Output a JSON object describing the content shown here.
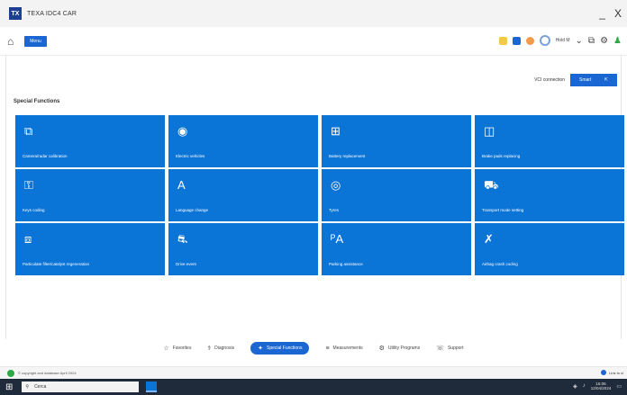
{
  "window": {
    "logo_text": "TX",
    "title": "TEXA IDC4 CAR",
    "minimize": "_",
    "close": "X"
  },
  "toolbar": {
    "home": "⌂",
    "menu_label": "Menu",
    "user_name": "Hold M"
  },
  "connection": {
    "label": "VCI connection",
    "button_label": "Smart",
    "button_icon": "⇱"
  },
  "section": {
    "title": "Special Functions"
  },
  "tiles": [
    {
      "label": "Camera/radar calibration",
      "icon": "⧉"
    },
    {
      "label": "Electric vehicles",
      "icon": "◉"
    },
    {
      "label": "Battery replacement",
      "icon": "⊞"
    },
    {
      "label": "Brake pads replacing",
      "icon": "◫"
    },
    {
      "label": "Keys coding",
      "icon": "⚿"
    },
    {
      "label": "Language change",
      "icon": "A"
    },
    {
      "label": "Tyres",
      "icon": "◎"
    },
    {
      "label": "Transport mode setting",
      "icon": "⛟"
    },
    {
      "label": "Particulate filter/catalyst regeneration",
      "icon": "⧈"
    },
    {
      "label": "Drive event",
      "icon": "⛐"
    },
    {
      "label": "Parking assistance",
      "icon": "ᴾA"
    },
    {
      "label": "Airbag crash coding",
      "icon": "✗"
    }
  ],
  "bottom_tabs": [
    {
      "label": "Favorites",
      "icon": "☆",
      "active": false
    },
    {
      "label": "Diagnosis",
      "icon": "⚕",
      "active": false
    },
    {
      "label": "Special Functions",
      "icon": "✦",
      "active": true
    },
    {
      "label": "Measurements",
      "icon": "≡",
      "active": false
    },
    {
      "label": "Utility Programs",
      "icon": "⚙",
      "active": false
    },
    {
      "label": "Support",
      "icon": "☏",
      "active": false
    }
  ],
  "status": {
    "text": "© copyright and database April 2024",
    "right_text": "Link to cl"
  },
  "taskbar": {
    "search_placeholder": "Cerca",
    "time": "16:06",
    "date": "12/04/2024"
  },
  "colors": {
    "accent": "#0b74d7",
    "brand": "#1c3f94"
  }
}
